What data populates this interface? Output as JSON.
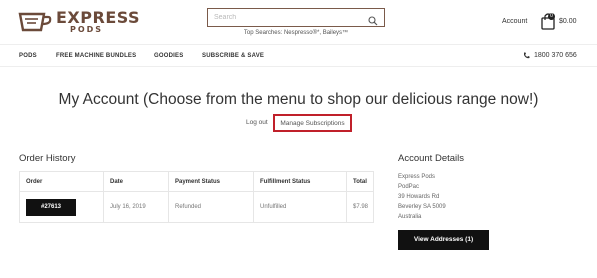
{
  "header": {
    "logo_line1": "EXPRESS",
    "logo_line2": "PODS",
    "search_placeholder": "Search",
    "top_searches": "Top Searches: Nespresso®*, Baileys™",
    "account_label": "Account",
    "cart_count": "0",
    "cart_total": "$0.00"
  },
  "nav": {
    "items": [
      "PODS",
      "FREE MACHINE BUNDLES",
      "GOODIES",
      "SUBSCRIBE & SAVE"
    ],
    "phone": "1800 370 656"
  },
  "main": {
    "title": "My Account (Choose from the menu to shop our delicious range now!)",
    "logout_label": "Log out",
    "manage_subscriptions_label": "Manage Subscriptions"
  },
  "order_history": {
    "title": "Order History",
    "columns": [
      "Order",
      "Date",
      "Payment Status",
      "Fulfillment Status",
      "Total"
    ],
    "rows": [
      {
        "order": "#27613",
        "date": "July 16, 2019",
        "payment_status": "Refunded",
        "fulfillment_status": "Unfulfilled",
        "total": "$7.98"
      }
    ]
  },
  "account_details": {
    "title": "Account Details",
    "address_lines": [
      "Express Pods",
      "PodPac",
      "39 Howards Rd",
      "Beverley SA 5009",
      "Australia"
    ],
    "view_addresses_label": "View Addresses (1)"
  },
  "colors": {
    "brand_brown": "#6b4a3a",
    "highlight_red": "#c0202a",
    "button_black": "#111111"
  }
}
